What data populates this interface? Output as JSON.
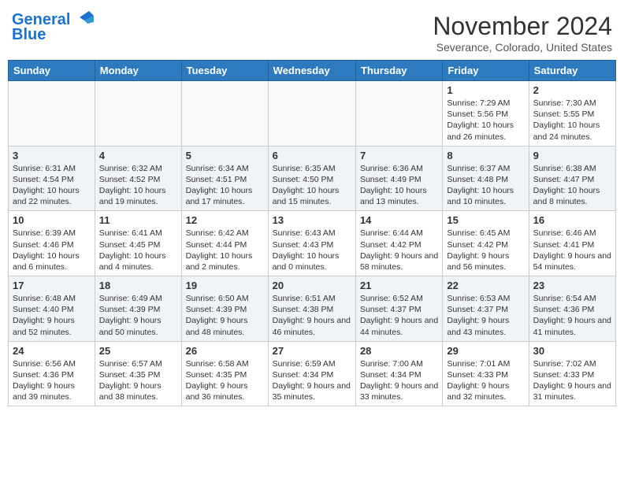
{
  "header": {
    "logo_line1": "General",
    "logo_line2": "Blue",
    "month": "November 2024",
    "location": "Severance, Colorado, United States"
  },
  "weekdays": [
    "Sunday",
    "Monday",
    "Tuesday",
    "Wednesday",
    "Thursday",
    "Friday",
    "Saturday"
  ],
  "weeks": [
    [
      {
        "day": "",
        "info": ""
      },
      {
        "day": "",
        "info": ""
      },
      {
        "day": "",
        "info": ""
      },
      {
        "day": "",
        "info": ""
      },
      {
        "day": "",
        "info": ""
      },
      {
        "day": "1",
        "info": "Sunrise: 7:29 AM\nSunset: 5:56 PM\nDaylight: 10 hours and 26 minutes."
      },
      {
        "day": "2",
        "info": "Sunrise: 7:30 AM\nSunset: 5:55 PM\nDaylight: 10 hours and 24 minutes."
      }
    ],
    [
      {
        "day": "3",
        "info": "Sunrise: 6:31 AM\nSunset: 4:54 PM\nDaylight: 10 hours and 22 minutes."
      },
      {
        "day": "4",
        "info": "Sunrise: 6:32 AM\nSunset: 4:52 PM\nDaylight: 10 hours and 19 minutes."
      },
      {
        "day": "5",
        "info": "Sunrise: 6:34 AM\nSunset: 4:51 PM\nDaylight: 10 hours and 17 minutes."
      },
      {
        "day": "6",
        "info": "Sunrise: 6:35 AM\nSunset: 4:50 PM\nDaylight: 10 hours and 15 minutes."
      },
      {
        "day": "7",
        "info": "Sunrise: 6:36 AM\nSunset: 4:49 PM\nDaylight: 10 hours and 13 minutes."
      },
      {
        "day": "8",
        "info": "Sunrise: 6:37 AM\nSunset: 4:48 PM\nDaylight: 10 hours and 10 minutes."
      },
      {
        "day": "9",
        "info": "Sunrise: 6:38 AM\nSunset: 4:47 PM\nDaylight: 10 hours and 8 minutes."
      }
    ],
    [
      {
        "day": "10",
        "info": "Sunrise: 6:39 AM\nSunset: 4:46 PM\nDaylight: 10 hours and 6 minutes."
      },
      {
        "day": "11",
        "info": "Sunrise: 6:41 AM\nSunset: 4:45 PM\nDaylight: 10 hours and 4 minutes."
      },
      {
        "day": "12",
        "info": "Sunrise: 6:42 AM\nSunset: 4:44 PM\nDaylight: 10 hours and 2 minutes."
      },
      {
        "day": "13",
        "info": "Sunrise: 6:43 AM\nSunset: 4:43 PM\nDaylight: 10 hours and 0 minutes."
      },
      {
        "day": "14",
        "info": "Sunrise: 6:44 AM\nSunset: 4:42 PM\nDaylight: 9 hours and 58 minutes."
      },
      {
        "day": "15",
        "info": "Sunrise: 6:45 AM\nSunset: 4:42 PM\nDaylight: 9 hours and 56 minutes."
      },
      {
        "day": "16",
        "info": "Sunrise: 6:46 AM\nSunset: 4:41 PM\nDaylight: 9 hours and 54 minutes."
      }
    ],
    [
      {
        "day": "17",
        "info": "Sunrise: 6:48 AM\nSunset: 4:40 PM\nDaylight: 9 hours and 52 minutes."
      },
      {
        "day": "18",
        "info": "Sunrise: 6:49 AM\nSunset: 4:39 PM\nDaylight: 9 hours and 50 minutes."
      },
      {
        "day": "19",
        "info": "Sunrise: 6:50 AM\nSunset: 4:39 PM\nDaylight: 9 hours and 48 minutes."
      },
      {
        "day": "20",
        "info": "Sunrise: 6:51 AM\nSunset: 4:38 PM\nDaylight: 9 hours and 46 minutes."
      },
      {
        "day": "21",
        "info": "Sunrise: 6:52 AM\nSunset: 4:37 PM\nDaylight: 9 hours and 44 minutes."
      },
      {
        "day": "22",
        "info": "Sunrise: 6:53 AM\nSunset: 4:37 PM\nDaylight: 9 hours and 43 minutes."
      },
      {
        "day": "23",
        "info": "Sunrise: 6:54 AM\nSunset: 4:36 PM\nDaylight: 9 hours and 41 minutes."
      }
    ],
    [
      {
        "day": "24",
        "info": "Sunrise: 6:56 AM\nSunset: 4:36 PM\nDaylight: 9 hours and 39 minutes."
      },
      {
        "day": "25",
        "info": "Sunrise: 6:57 AM\nSunset: 4:35 PM\nDaylight: 9 hours and 38 minutes."
      },
      {
        "day": "26",
        "info": "Sunrise: 6:58 AM\nSunset: 4:35 PM\nDaylight: 9 hours and 36 minutes."
      },
      {
        "day": "27",
        "info": "Sunrise: 6:59 AM\nSunset: 4:34 PM\nDaylight: 9 hours and 35 minutes."
      },
      {
        "day": "28",
        "info": "Sunrise: 7:00 AM\nSunset: 4:34 PM\nDaylight: 9 hours and 33 minutes."
      },
      {
        "day": "29",
        "info": "Sunrise: 7:01 AM\nSunset: 4:33 PM\nDaylight: 9 hours and 32 minutes."
      },
      {
        "day": "30",
        "info": "Sunrise: 7:02 AM\nSunset: 4:33 PM\nDaylight: 9 hours and 31 minutes."
      }
    ]
  ]
}
